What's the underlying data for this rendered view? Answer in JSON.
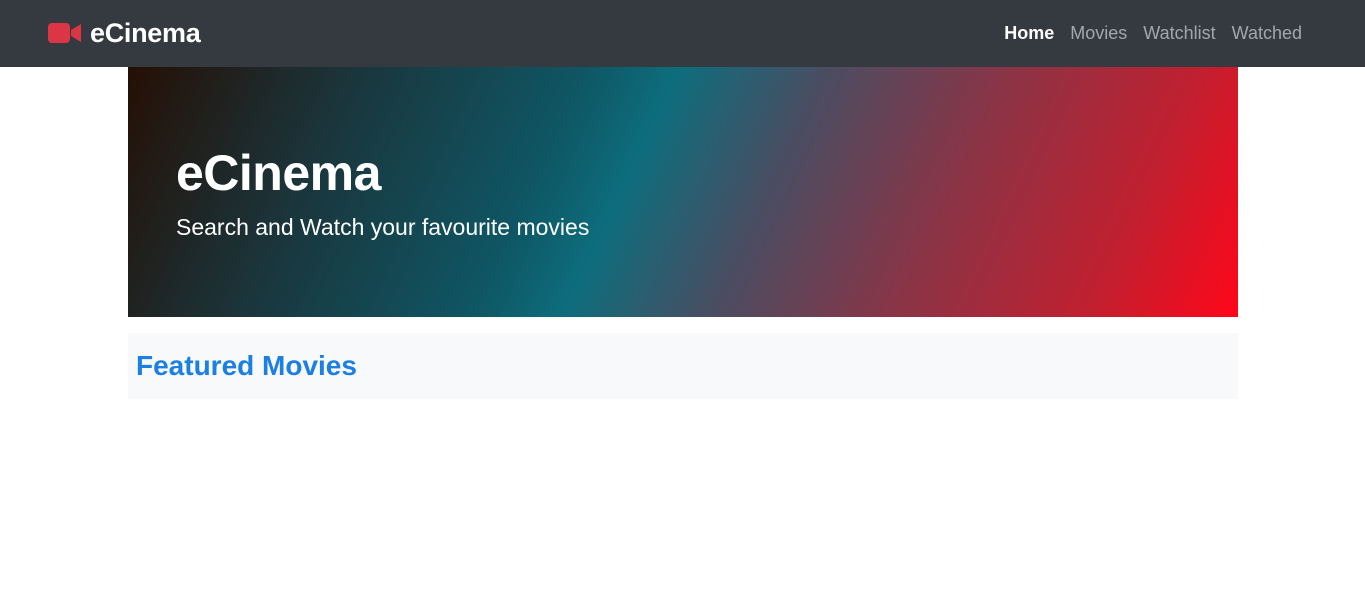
{
  "navbar": {
    "brand": {
      "icon": "video-camera-icon",
      "icon_color": "#dc3545",
      "label": "eCinema"
    },
    "links": [
      {
        "label": "Home",
        "active": true
      },
      {
        "label": "Movies",
        "active": false
      },
      {
        "label": "Watchlist",
        "active": false
      },
      {
        "label": "Watched",
        "active": false
      }
    ],
    "background": "#343a40"
  },
  "hero": {
    "title": "eCinema",
    "subtitle": "Search and Watch your favourite movies"
  },
  "featured": {
    "title": "Featured Movies",
    "title_color": "#1b7fe3"
  }
}
